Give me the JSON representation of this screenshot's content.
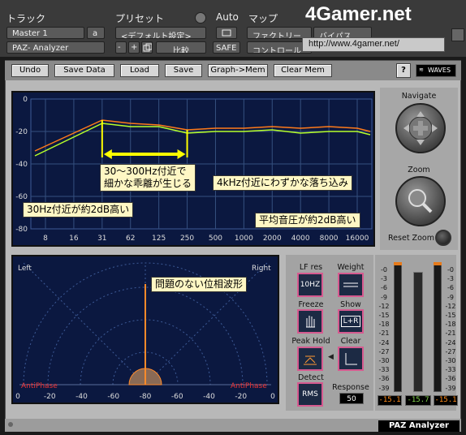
{
  "host": {
    "track_label": "トラック",
    "preset_label": "プリセット",
    "auto_label": "Auto",
    "map_label": "マップ",
    "track_select": "Master 1",
    "track_channel": "a",
    "plugin_select": "PAZ- Analyzer",
    "preset_select": "<デフォルト設定>",
    "preset_minus": "-",
    "preset_plus": "+",
    "compare_label": "比較",
    "safe_label": "SAFE",
    "factory_label": "ファクトリー",
    "bypass_label": "バイパス",
    "control_label": "コントロール",
    "watermark_logo": "4Gamer.net",
    "watermark_url": "http://www.4gamer.net/"
  },
  "toolbar": {
    "undo": "Undo",
    "save_data": "Save Data",
    "load": "Load",
    "save": "Save",
    "graph_mem": "Graph->Mem",
    "clear_mem": "Clear Mem",
    "help": "?",
    "brand": "WAVES"
  },
  "navigate": {
    "navigate_label": "Navigate",
    "zoom_label": "Zoom",
    "reset_zoom_label": "Reset Zoom"
  },
  "spectrum": {
    "y_ticks": [
      "0",
      "-20",
      "-40",
      "-60",
      "-80"
    ],
    "x_ticks": [
      "8",
      "16",
      "31",
      "62",
      "125",
      "250",
      "500",
      "1000",
      "2000",
      "4000",
      "8000",
      "16000"
    ],
    "callout_30hz": "30Hz付近が約2dB高い",
    "callout_range_1": "30～300Hz付近で",
    "callout_range_2": "細かな乖離が生じる",
    "callout_4k": "4kHz付近にわずかな落ち込み",
    "callout_avg": "平均音圧が約2dB高い",
    "colors": {
      "orange": "#ff7a1a",
      "green": "#b6ff2a",
      "yellow": "#ffff00"
    }
  },
  "phase": {
    "left": "Left",
    "right": "Right",
    "antiphase_left": "AntiPhase",
    "antiphase_right": "AntiPhase",
    "callout": "問題のない位相波形",
    "x_ticks": [
      "0",
      "-20",
      "-40",
      "-60",
      "-80",
      "-60",
      "-40",
      "-20",
      "0"
    ]
  },
  "controls": {
    "lf_res_label": "LF res",
    "lf_res_value": "10HZ",
    "weight_label": "Weight",
    "freeze_label": "Freeze",
    "show_label": "Show",
    "show_value": "L+R",
    "peak_hold_label": "Peak Hold",
    "clear_label": "Clear",
    "detect_label": "Detect",
    "detect_value": "RMS",
    "response_label": "Response",
    "response_value": "50"
  },
  "meters": {
    "scale": [
      "-0",
      "-3",
      "-6",
      "-9",
      "-12",
      "-15",
      "-18",
      "-21",
      "-24",
      "-27",
      "-30",
      "-33",
      "-36",
      "-39"
    ],
    "readout_left": "-15.1",
    "readout_mid": "-15.7",
    "readout_right": "-15.1"
  },
  "footer": {
    "title": "PAZ Analyzer"
  }
}
